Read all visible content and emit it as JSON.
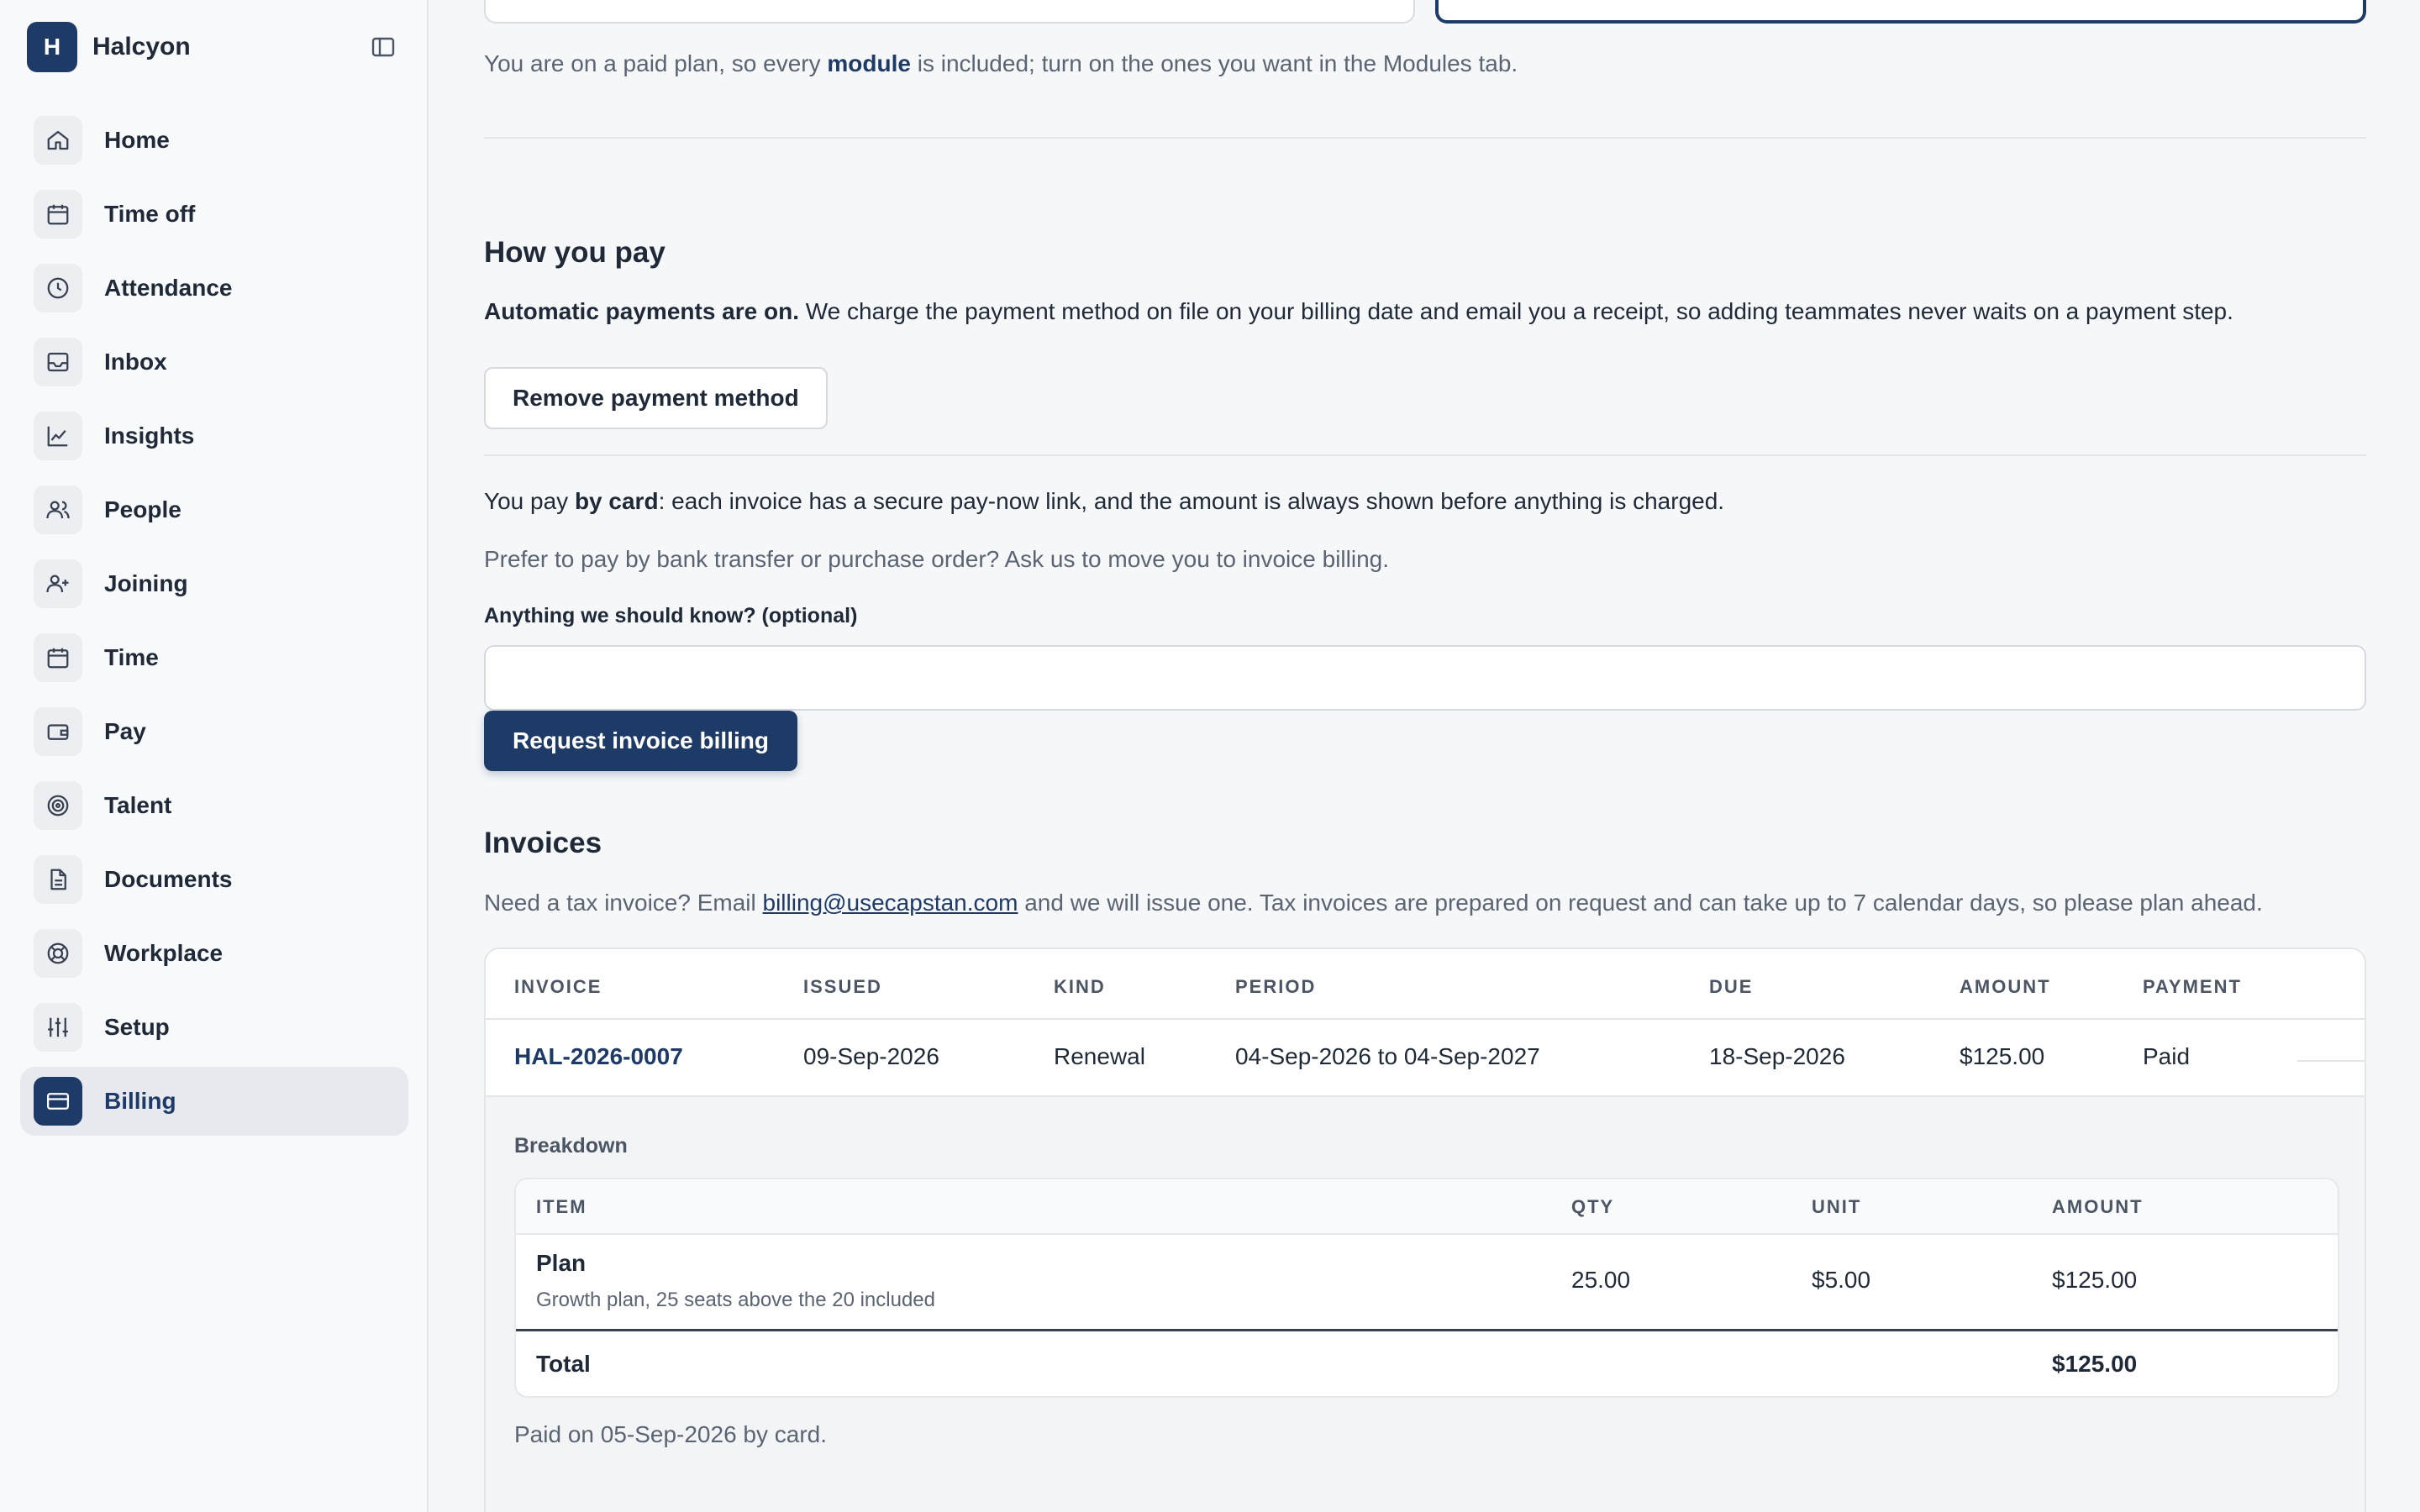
{
  "app": {
    "initial": "H",
    "name": "Halcyon"
  },
  "nav": [
    {
      "label": "Home",
      "icon": "home-icon"
    },
    {
      "label": "Time off",
      "icon": "calendar-icon"
    },
    {
      "label": "Attendance",
      "icon": "clock-icon"
    },
    {
      "label": "Inbox",
      "icon": "inbox-icon"
    },
    {
      "label": "Insights",
      "icon": "chart-line-icon"
    },
    {
      "label": "People",
      "icon": "users-icon"
    },
    {
      "label": "Joining",
      "icon": "user-plus-icon"
    },
    {
      "label": "Time",
      "icon": "calendar-icon"
    },
    {
      "label": "Pay",
      "icon": "wallet-icon"
    },
    {
      "label": "Talent",
      "icon": "target-icon"
    },
    {
      "label": "Documents",
      "icon": "document-icon"
    },
    {
      "label": "Workplace",
      "icon": "lifebuoy-icon"
    },
    {
      "label": "Setup",
      "icon": "sliders-icon"
    },
    {
      "label": "Billing",
      "icon": "credit-card-icon",
      "active": true
    }
  ],
  "plan_note": {
    "before": "You are on a paid plan, so every ",
    "emphasis": "module",
    "after": " is included; turn on the ones you want in the Modules tab."
  },
  "how_you_pay": {
    "title": "How you pay",
    "auto_bold": "Automatic payments are on.",
    "auto_rest": " We charge the payment method on file on your billing date and email you a receipt, so adding teammates never waits on a payment step.",
    "remove_button": "Remove payment method",
    "card_before": "You pay ",
    "card_bold": "by card",
    "card_after": ": each invoice has a secure pay-now link, and the amount is always shown before anything is charged.",
    "alt_note": "Prefer to pay by bank transfer or purchase order? Ask us to move you to invoice billing.",
    "field_label": "Anything we should know? (optional)",
    "field_value": "",
    "field_placeholder": "",
    "request_button": "Request invoice billing"
  },
  "invoices": {
    "title": "Invoices",
    "note_before": "Need a tax invoice? Email ",
    "note_email": "billing@usecapstan.com",
    "note_after": " and we will issue one. Tax invoices are prepared on request and can take up to 7 calendar days, so please plan ahead.",
    "columns": [
      "INVOICE",
      "ISSUED",
      "KIND",
      "PERIOD",
      "DUE",
      "AMOUNT",
      "PAYMENT"
    ],
    "rows": [
      {
        "invoice": "HAL-2026-0007",
        "issued": "09-Sep-2026",
        "kind": "Renewal",
        "period": "04-Sep-2026 to 04-Sep-2027",
        "due": "18-Sep-2026",
        "amount": "$125.00",
        "payment": "Paid"
      }
    ],
    "breakdown": {
      "title": "Breakdown",
      "columns": [
        "ITEM",
        "QTY",
        "UNIT",
        "AMOUNT"
      ],
      "items": [
        {
          "name": "Plan",
          "desc": "Growth plan, 25 seats above the 20 included",
          "qty": "25.00",
          "unit": "$5.00",
          "amount": "$125.00"
        }
      ],
      "total_label": "Total",
      "total_amount": "$125.00"
    },
    "paid_note": "Paid on 05-Sep-2026 by card."
  }
}
